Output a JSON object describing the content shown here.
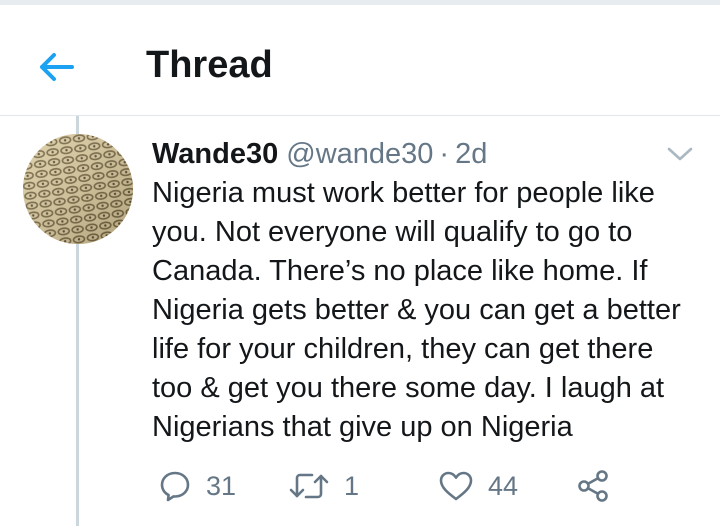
{
  "header": {
    "title": "Thread",
    "back_icon": "arrow-left-icon",
    "accent_color": "#1da1f2"
  },
  "tweet": {
    "display_name": "Wande30",
    "handle": "@wande30",
    "separator": "·",
    "time": "2d",
    "text": "Nigeria must work better for people like\nyou. Not everyone will qualify to go to\nCanada. There’s no place like home. If\nNigeria gets better & you can get a better\nlife for your children, they can get there\ntoo & get you there some day. I laugh at\nNigerians that give up on Nigeria",
    "caret_icon": "chevron-down-icon",
    "avatar_icon": "fabric-pattern-avatar"
  },
  "actions": {
    "reply": {
      "icon": "reply-icon",
      "count": "31"
    },
    "retweet": {
      "icon": "retweet-icon",
      "count": "1"
    },
    "like": {
      "icon": "heart-icon",
      "count": "44"
    },
    "share": {
      "icon": "share-icon"
    }
  },
  "colors": {
    "text_primary": "#14171a",
    "text_secondary": "#657786",
    "divider": "#e1e8ed",
    "thread_line": "#ccd6dd"
  }
}
